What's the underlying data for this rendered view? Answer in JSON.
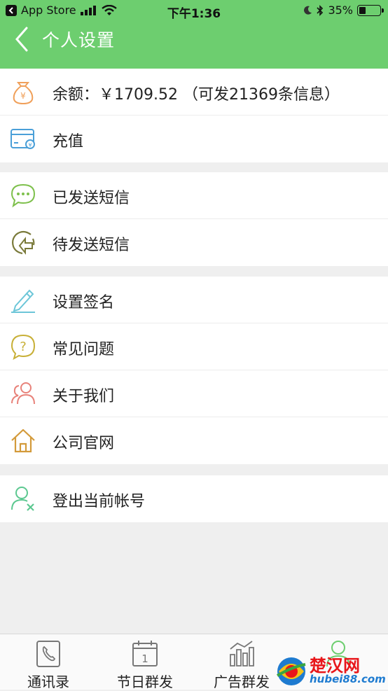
{
  "status_bar": {
    "back_app": "App Store",
    "time": "下午1:36",
    "battery": "35%",
    "battery_level": 0.35
  },
  "nav": {
    "title": "个人设置"
  },
  "groups": [
    {
      "items": [
        {
          "label": "余额：￥1709.52 （可发21369条信息）",
          "icon": "money-bag-icon"
        },
        {
          "label": "充值",
          "icon": "recharge-card-icon"
        }
      ]
    },
    {
      "items": [
        {
          "label": "已发送短信",
          "icon": "chat-bubble-icon"
        },
        {
          "label": "待发送短信",
          "icon": "pending-send-icon"
        }
      ]
    },
    {
      "items": [
        {
          "label": "设置签名",
          "icon": "pencil-icon"
        },
        {
          "label": "常见问题",
          "icon": "question-bubble-icon"
        },
        {
          "label": "关于我们",
          "icon": "people-icon"
        },
        {
          "label": "公司官网",
          "icon": "home-icon"
        }
      ]
    },
    {
      "items": [
        {
          "label": "登出当前帐号",
          "icon": "logout-user-icon"
        }
      ]
    }
  ],
  "tabbar": [
    {
      "label": "通讯录",
      "icon": "contacts-phone-icon"
    },
    {
      "label": "节日群发",
      "icon": "calendar-icon"
    },
    {
      "label": "广告群发",
      "icon": "bar-chart-icon"
    },
    {
      "label": "",
      "icon": "profile-user-icon"
    }
  ],
  "watermark": {
    "cn": "楚汉网",
    "en": "hubei88.com"
  },
  "colors": {
    "header_green": "#6dce6f",
    "background": "#efefef"
  }
}
